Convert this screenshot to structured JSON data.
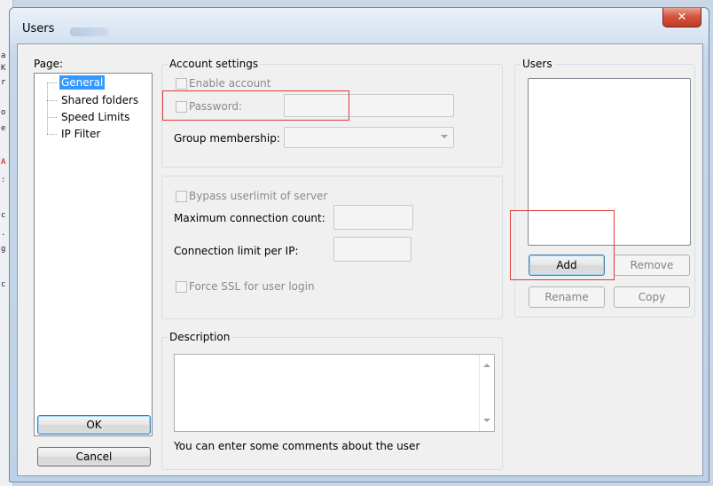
{
  "window": {
    "title": "Users",
    "close_glyph": "✕"
  },
  "page_panel": {
    "label": "Page:",
    "items": [
      {
        "label": "General",
        "selected": true
      },
      {
        "label": "Shared folders",
        "selected": false
      },
      {
        "label": "Speed Limits",
        "selected": false
      },
      {
        "label": "IP Filter",
        "selected": false
      }
    ]
  },
  "account_settings": {
    "group_label": "Account settings",
    "enable_account": "Enable account",
    "password": "Password:",
    "password_value": "",
    "group_membership": "Group membership:",
    "group_membership_value": ""
  },
  "limits": {
    "bypass": "Bypass userlimit of server",
    "max_connections": "Maximum connection count:",
    "max_connections_value": "",
    "limit_per_ip": "Connection limit per IP:",
    "limit_per_ip_value": "",
    "force_ssl": "Force SSL for user login"
  },
  "users": {
    "group_label": "Users",
    "items": [],
    "add": "Add",
    "remove": "Remove",
    "rename": "Rename",
    "copy": "Copy"
  },
  "description": {
    "group_label": "Description",
    "value": "",
    "hint": "You can enter some comments about the user"
  },
  "buttons": {
    "ok": "OK",
    "cancel": "Cancel"
  },
  "colors": {
    "selection": "#3399ff",
    "highlight_box": "#e03a3a"
  },
  "icons": [
    "close-icon",
    "tree-lines",
    "chevron-down-icon",
    "scroll-up-icon",
    "scroll-down-icon"
  ]
}
